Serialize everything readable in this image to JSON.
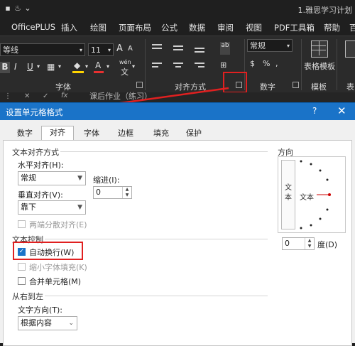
{
  "window": {
    "document_title": "1.雅思学习计划"
  },
  "ribbon_tabs": [
    "OfficePLUS",
    "插入",
    "绘图",
    "页面布局",
    "公式",
    "数据",
    "审阅",
    "视图",
    "PDF工具箱",
    "帮助",
    "百"
  ],
  "ribbon": {
    "font_name": "等线",
    "font_size": "11",
    "grow_font": "A",
    "shrink_font": "A",
    "bold": "B",
    "italic": "I",
    "underline": "U",
    "phonetic_glyph": "wén",
    "number_format": "常规",
    "table_template_label": "表格模板",
    "groups": {
      "font": "字体",
      "alignment": "对齐方式",
      "number": "数字",
      "template": "模板"
    }
  },
  "formula_bar": {
    "fx": "fx",
    "content": "课后作业（练习）"
  },
  "dialog": {
    "title": "设置单元格格式",
    "help": "?",
    "close": "✕",
    "tabs": [
      "数字",
      "对齐",
      "字体",
      "边框",
      "填充",
      "保护"
    ],
    "selected_tab": "对齐",
    "text_alignment": {
      "section": "文本对齐方式",
      "horizontal_label": "水平对齐(H):",
      "horizontal_value": "常规",
      "indent_label": "缩进(I):",
      "indent_value": "0",
      "vertical_label": "垂直对齐(V):",
      "vertical_value": "靠下",
      "justify_distributed": "两端分散对齐(E)"
    },
    "text_control": {
      "section": "文本控制",
      "wrap_text": "自动换行(W)",
      "wrap_text_checked": true,
      "shrink_to_fit": "缩小字体填充(K)",
      "merge_cells": "合并单元格(M)"
    },
    "rtl": {
      "section": "从右到左",
      "direction_label": "文字方向(T):",
      "direction_value": "根据内容"
    },
    "orientation": {
      "section": "方向",
      "vertical_text": "文本",
      "horizontal_text": "文本",
      "degrees_value": "0",
      "degrees_label": "度(D)"
    }
  },
  "colors": {
    "title_blue": "#1a73c8",
    "annotation_red": "#e02020",
    "highlight_yellow": "#ffd400",
    "font_red": "#e83030"
  }
}
